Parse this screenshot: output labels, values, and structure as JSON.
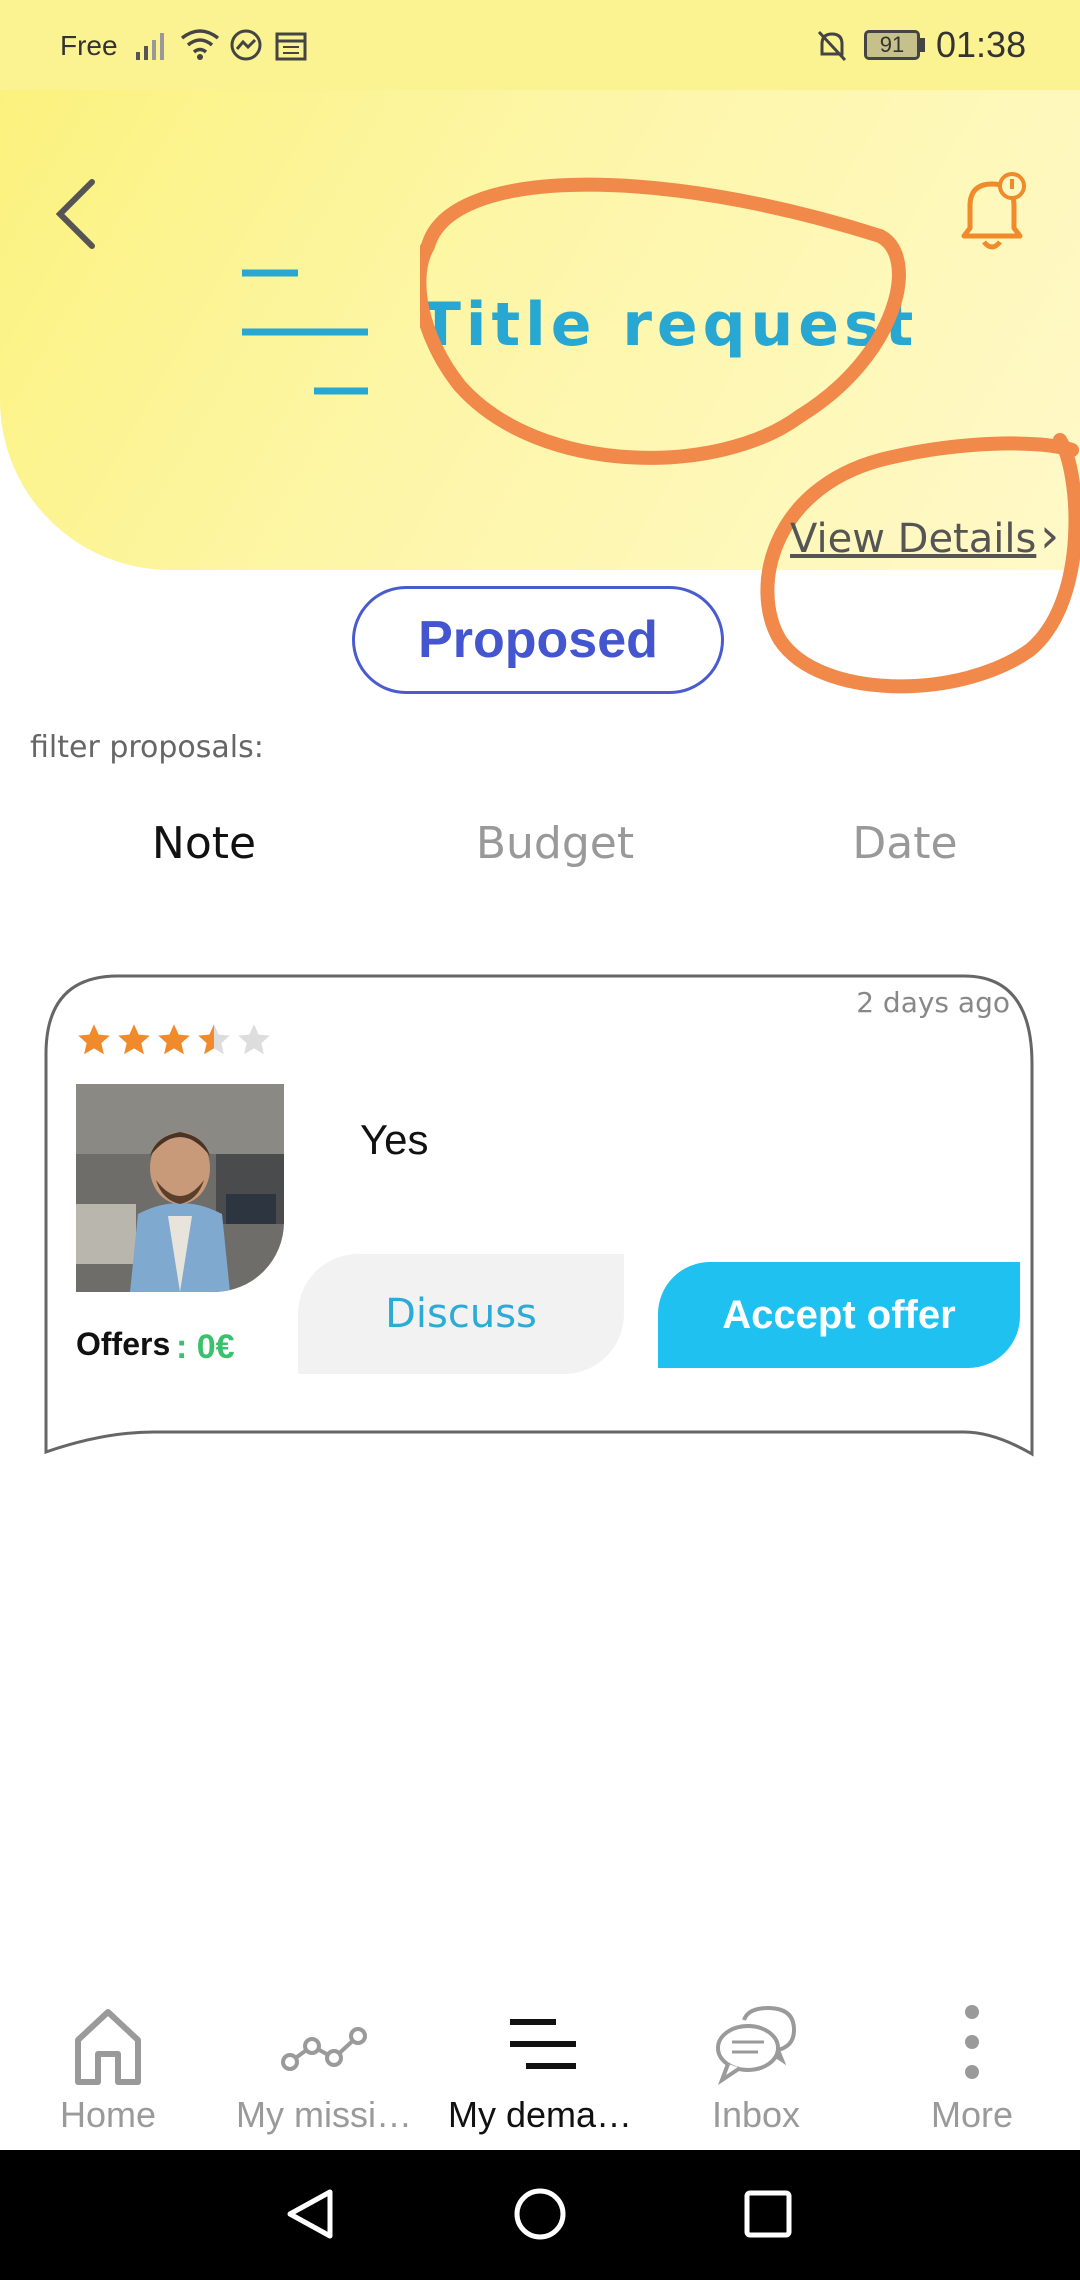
{
  "status_bar": {
    "carrier": "Free",
    "battery": "91",
    "time": "01:38"
  },
  "header": {
    "back_icon": "chevron-left-icon",
    "menu_icon": "menu-lines-icon",
    "title": "Title request",
    "notification_icon": "bell-icon",
    "view_details": "View Details",
    "view_details_chevron": "›",
    "accent_color": "#27a7d1"
  },
  "request_status": "Proposed",
  "filter": {
    "label": "filter proposals:",
    "tabs": [
      {
        "label": "Note",
        "active": true
      },
      {
        "label": "Budget",
        "active": false
      },
      {
        "label": "Date",
        "active": false
      }
    ]
  },
  "proposal": {
    "rating": 3.5,
    "rating_max": 5,
    "time_ago": "2 days ago",
    "message": "Yes",
    "offers_label": "Offers",
    "offers_value": ": 0€",
    "discuss_label": "Discuss",
    "accept_label": "Accept offer"
  },
  "bottom_nav": [
    {
      "label": "Home",
      "icon": "home-icon",
      "active": false
    },
    {
      "label": "My missi…",
      "icon": "missions-graph-icon",
      "active": false
    },
    {
      "label": "My dema…",
      "icon": "requests-menu-icon",
      "active": true
    },
    {
      "label": "Inbox",
      "icon": "chat-bubbles-icon",
      "active": false
    },
    {
      "label": "More",
      "icon": "more-vertical-icon",
      "active": false
    }
  ],
  "system_nav": {
    "back": "back-triangle-icon",
    "home": "home-circle-icon",
    "recents": "recents-square-icon"
  },
  "colors": {
    "header_yellow": "#fbf27e",
    "status_blue": "#4356cf",
    "accept_blue": "#1fc1f1",
    "offers_green": "#39c16c",
    "annotation_orange": "#f0894a",
    "star_orange": "#f08a2b"
  }
}
